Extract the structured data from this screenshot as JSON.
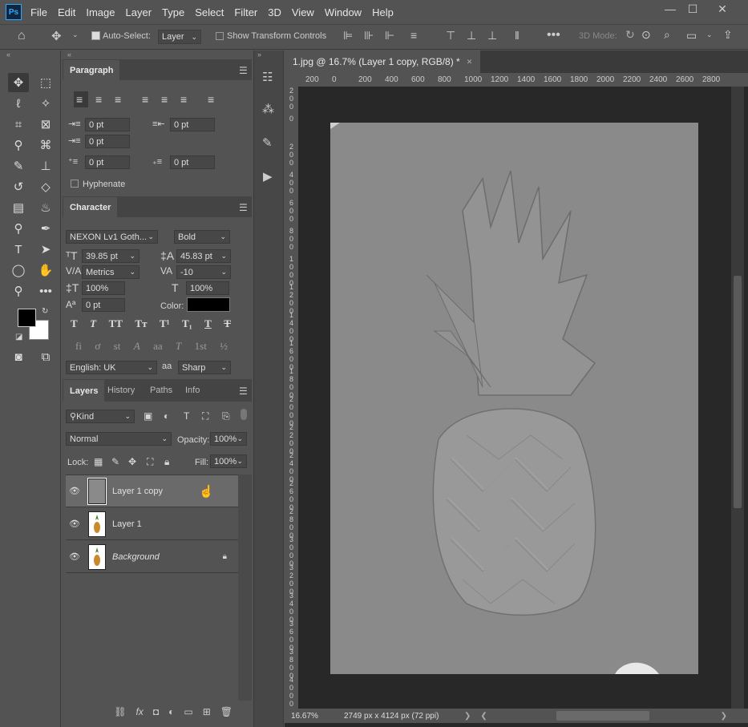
{
  "app": {
    "logo": "Ps"
  },
  "menubar": {
    "items": [
      "File",
      "Edit",
      "Image",
      "Layer",
      "Type",
      "Select",
      "Filter",
      "3D",
      "View",
      "Window",
      "Help"
    ]
  },
  "window_controls": {
    "minimize": "—",
    "restore": "☐",
    "close": "✕"
  },
  "options": {
    "auto_select_label": "Auto-Select:",
    "auto_select_value": "Layer",
    "show_transform_label": "Show Transform Controls",
    "mode_label": "3D Mode:"
  },
  "paragraph": {
    "tab": "Paragraph",
    "indent_left": "0 pt",
    "indent_right": "0 pt",
    "indent_first": "0 pt",
    "space_before": "0 pt",
    "space_after": "0 pt",
    "hyphenate": "Hyphenate"
  },
  "character": {
    "tab": "Character",
    "font": "NEXON Lv1 Goth...",
    "style": "Bold",
    "size": "39.85 pt",
    "leading": "45.83 pt",
    "kerning": "Metrics",
    "tracking": "-10",
    "vscale": "100%",
    "hscale": "100%",
    "baseline": "0 pt",
    "color_label": "Color:",
    "color": "#000000",
    "language": "English: UK",
    "antialias_icon": "aa",
    "antialias": "Sharp",
    "style_buttons": [
      "T",
      "T",
      "TT",
      "Tт",
      "T¹",
      "T₁",
      "T",
      "T"
    ],
    "otf_buttons": [
      "fi",
      "ơ",
      "st",
      "A",
      "aa",
      "T",
      "1st",
      "½"
    ]
  },
  "layers_panel": {
    "tabs": [
      "Layers",
      "History",
      "Paths",
      "Info"
    ],
    "filter": "Kind",
    "blend_mode": "Normal",
    "opacity_label": "Opacity:",
    "opacity": "100%",
    "lock_label": "Lock:",
    "fill_label": "Fill:",
    "fill": "100%",
    "layers": [
      {
        "name": "Layer 1 copy",
        "selected": true
      },
      {
        "name": "Layer 1",
        "selected": false
      },
      {
        "name": "Background",
        "selected": false,
        "locked": true
      }
    ]
  },
  "document": {
    "tab_title": "1.jpg @ 16.7% (Layer 1 copy, RGB/8) *",
    "ruler_h": [
      "200",
      "0",
      "200",
      "400",
      "600",
      "800",
      "1000",
      "1200",
      "1400",
      "1600",
      "1800",
      "2000",
      "2200",
      "2400",
      "2600",
      "2800"
    ],
    "ruler_v": [
      "2\n0\n0",
      "0",
      "2\n0\n0",
      "4\n0\n0",
      "6\n0\n0",
      "8\n0\n0",
      "1\n0\n0\n0",
      "1\n2\n0\n0",
      "1\n4\n0\n0",
      "1\n6\n0\n0",
      "1\n8\n0\n0",
      "2\n0\n0\n0",
      "2\n2\n0\n0",
      "2\n4\n0\n0",
      "2\n6\n0\n0",
      "2\n8\n0\n0",
      "3\n0\n0\n0",
      "3\n2\n0\n0",
      "3\n4\n0\n0",
      "3\n6\n0\n0",
      "3\n8\n0\n0",
      "4\n0\n0\n0"
    ],
    "zoom": "16.67%",
    "info": "2749 px x 4124 px (72 ppi)"
  },
  "colors": {
    "ui": "#535353",
    "dark": "#282828",
    "canvas": "#8a8a8a"
  }
}
